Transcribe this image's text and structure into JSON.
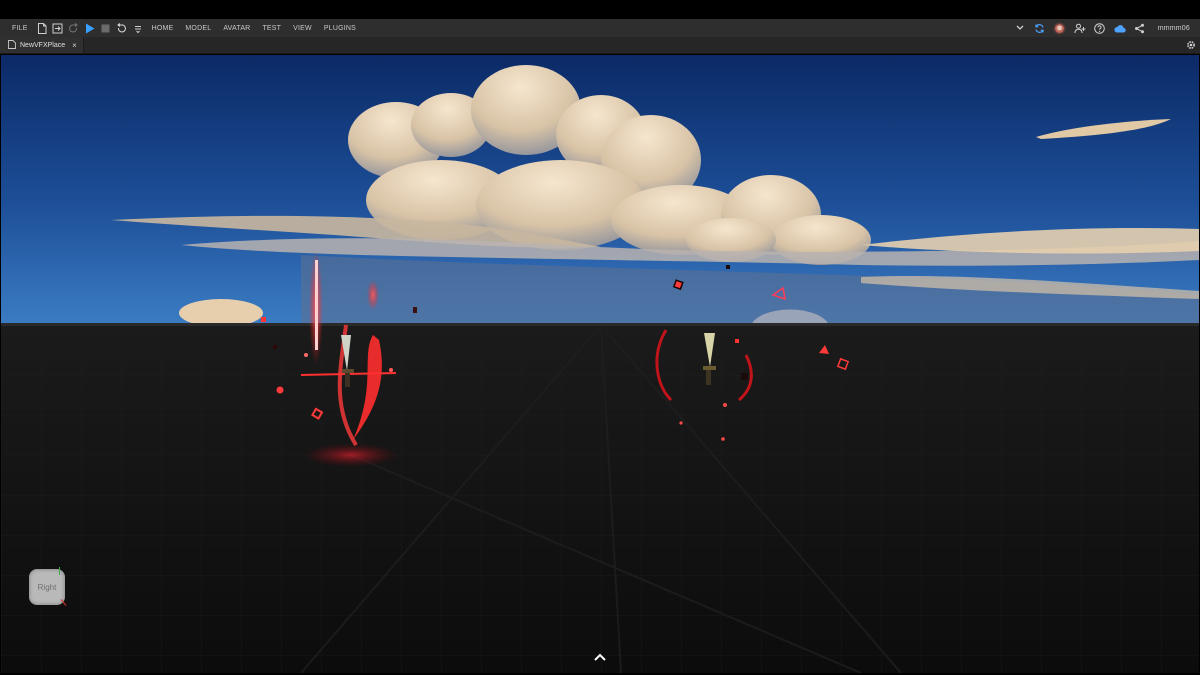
{
  "menubar": {
    "file_label": "FILE",
    "menus": [
      "HOME",
      "MODEL",
      "AVATAR",
      "TEST",
      "VIEW",
      "PLUGINS"
    ],
    "toolbar_icons": [
      "new-file-icon",
      "open-file-icon",
      "redo-icon",
      "play-icon",
      "stop-icon",
      "undo-icon",
      "more-icon"
    ],
    "right_icons": [
      "chevron-down-icon",
      "sync-icon",
      "avatar-icon",
      "collaborators-icon",
      "help-icon",
      "cloud-icon",
      "share-icon"
    ],
    "username": "mmmm06"
  },
  "tabs": [
    {
      "label": "NewVFXPlace",
      "active": true,
      "close": "×"
    }
  ],
  "viewport": {
    "view_cube_label": "Right",
    "sky_color": "#1f4f98",
    "ground_color": "#141414",
    "vfx_color": "#ff2a2a"
  },
  "colors": {
    "accent_play": "#3aa0ff",
    "menubar_bg": "#2e2e2e",
    "tabbar_bg": "#262626"
  }
}
